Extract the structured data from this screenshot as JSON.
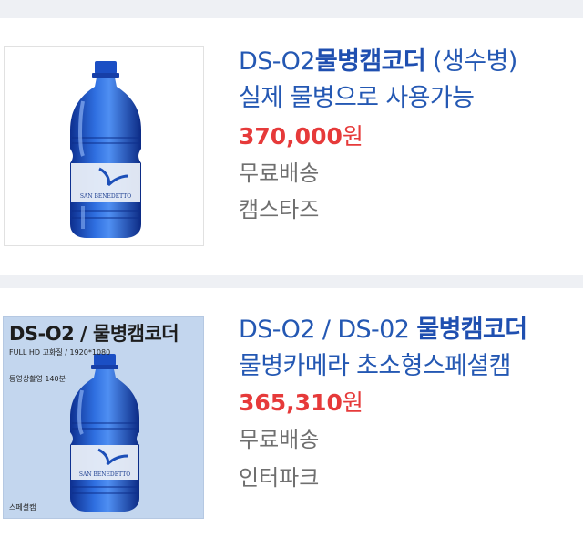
{
  "products": [
    {
      "title_prefix": "DS-O2",
      "title_bold": "물병캠코더",
      "title_suffix": " (생수병)",
      "subtitle": "실제 물병으로 사용가능",
      "price": "370,000",
      "currency": "원",
      "shipping": "무료배송",
      "seller": "캠스타즈",
      "image": {
        "bottle_label": "SAN BENEDETTO"
      }
    },
    {
      "title_prefix": "DS-O2 / DS-02 ",
      "title_bold": "물병캠코더",
      "title_suffix": "",
      "subtitle": "물병카메라 초소형스페셜캠",
      "price": "365,310",
      "currency": "원",
      "shipping": "무료배송",
      "seller": "인터파크",
      "image": {
        "title": "DS-O2 / 물병캠코더",
        "spec": "FULL HD 고화질 / 1920*1080",
        "recording": "동영상촬영 140분",
        "manual": "스페셜캠",
        "bottle_label": "SAN BENEDETTO"
      }
    }
  ],
  "colors": {
    "title_blue": "#2458b3",
    "price_red": "#e63a3a",
    "meta_gray": "#6f6f6f",
    "page_bg": "#eef0f4",
    "bottle_blue": "#1f58c8"
  }
}
